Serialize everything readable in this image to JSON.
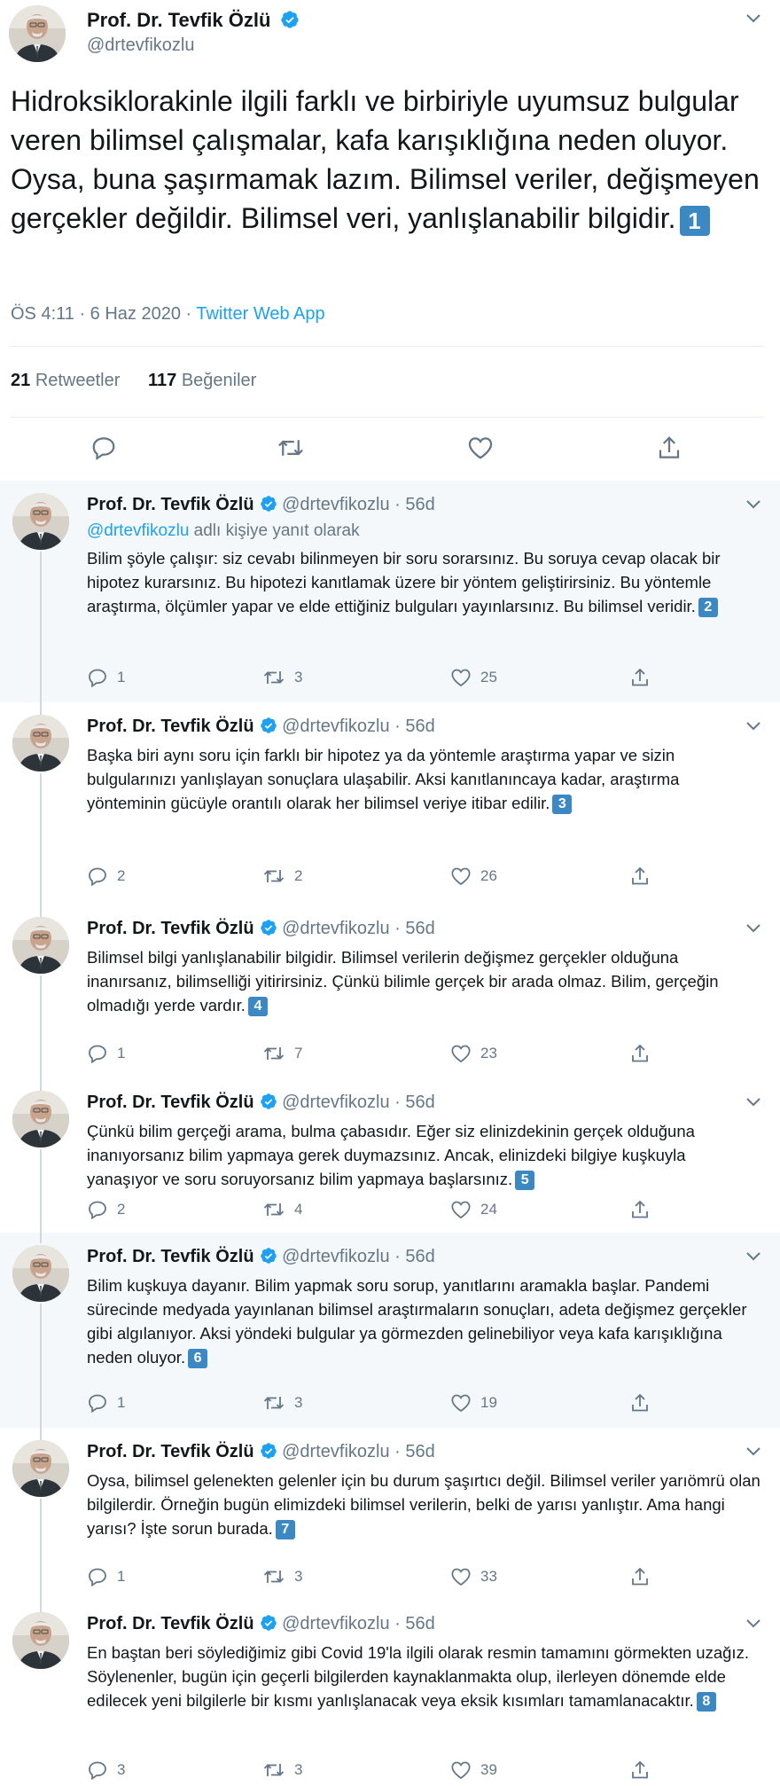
{
  "author": {
    "name": "Prof. Dr. Tevfik Özlü",
    "handle": "@drtevfikozlu"
  },
  "main_tweet": {
    "text": "Hidroksiklorakinle ilgili farklı ve birbiriyle uyumsuz bulgular veren bilimsel çalışmalar, kafa karışıklığına neden oluyor. Oysa, buna şaşırmamak lazım. Bilimsel veriler, değişmeyen gerçekler değildir. Bilimsel veri, yanlışlanabilir bilgidir.",
    "badge": "1",
    "time": "ÖS 4:11 · 6 Haz 2020 · ",
    "app": "Twitter Web App",
    "retweets_count": "21",
    "retweets_label": "Retweetler",
    "likes_count": "117",
    "likes_label": "Beğeniler"
  },
  "replies": [
    {
      "handle": "@drtevfikozlu",
      "age": "· 56d",
      "reply_to_mention": "@drtevfikozlu",
      "reply_to_text": " adlı kişiye yanıt olarak",
      "text": "Bilim şöyle çalışır: siz cevabı bilinmeyen bir soru sorarsınız. Bu soruya cevap olacak bir hipotez kurarsınız. Bu hipotezi kanıtlamak üzere bir yöntem geliştirirsiniz. Bu yöntemle araştırma, ölçümler yapar ve elde ettiğiniz bulguları yayınlarsınız. Bu bilimsel veridir.",
      "badge": "2",
      "replies": "1",
      "retweets": "3",
      "likes": "25"
    },
    {
      "handle": "@drtevfikozlu",
      "age": "· 56d",
      "text": "Başka biri aynı soru için farklı bir hipotez ya da yöntemle araştırma yapar ve sizin bulgularınızı yanlışlayan sonuçlara ulaşabilir. Aksi kanıtlanıncaya kadar, araştırma yönteminin gücüyle orantılı olarak her bilimsel veriye itibar edilir.",
      "badge": "3",
      "replies": "2",
      "retweets": "2",
      "likes": "26"
    },
    {
      "handle": "@drtevfikozlu",
      "age": "· 56d",
      "text": "Bilimsel bilgi yanlışlanabilir bilgidir. Bilimsel verilerin değişmez gerçekler olduğuna inanırsanız, bilimselliği yitirirsiniz. Çünkü bilimle gerçek bir arada olmaz. Bilim, gerçeğin olmadığı yerde vardır.",
      "badge": "4",
      "replies": "1",
      "retweets": "7",
      "likes": "23"
    },
    {
      "handle": "@drtevfikozlu",
      "age": "· 56d",
      "text": "Çünkü bilim gerçeği arama, bulma çabasıdır. Eğer siz elinizdekinin gerçek olduğuna inanıyorsanız bilim yapmaya gerek duymazsınız. Ancak, elinizdeki bilgiye kuşkuyla yanaşıyor ve soru soruyorsanız bilim yapmaya başlarsınız.",
      "badge": "5",
      "replies": "2",
      "retweets": "4",
      "likes": "24"
    },
    {
      "handle": "@drtevfikozlu",
      "age": "· 56d",
      "text": "Bilim kuşkuya dayanır. Bilim yapmak soru sorup, yanıtlarını aramakla başlar. Pandemi sürecinde medyada yayınlanan bilimsel araştırmaların sonuçları, adeta değişmez gerçekler gibi algılanıyor. Aksi yöndeki bulgular ya görmezden gelinebiliyor veya kafa karışıklığına neden oluyor.",
      "badge": "6",
      "replies": "1",
      "retweets": "3",
      "likes": "19"
    },
    {
      "handle": "@drtevfikozlu",
      "age": "· 56d",
      "text": "Oysa, bilimsel gelenekten gelenler için bu durum şaşırtıcı değil. Bilimsel veriler yarıömrü olan bilgilerdir. Örneğin bugün elimizdeki bilimsel verilerin, belki de yarısı yanlıştır. Ama hangi yarısı? İşte sorun burada.",
      "badge": "7",
      "replies": "1",
      "retweets": "3",
      "likes": "33"
    },
    {
      "handle": "@drtevfikozlu",
      "age": "· 56d",
      "text": "En baştan beri söylediğimiz gibi Covid 19'la ilgili olarak resmin tamamını görmekten uzağız. Söylenenler, bugün için geçerli bilgilerden kaynaklanmakta olup, ilerleyen dönemde elde edilecek yeni bilgilerle bir kısmı yanlışlanacak veya eksik kısımları tamamlanacaktır.",
      "badge": "8",
      "replies": "3",
      "retweets": "3",
      "likes": "39"
    }
  ]
}
